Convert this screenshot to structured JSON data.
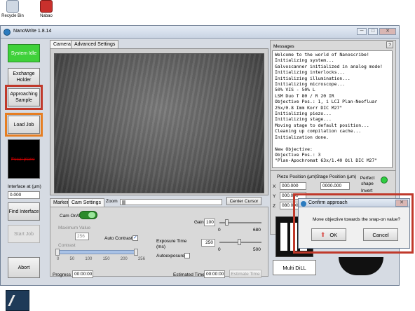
{
  "desktop": {
    "icons": [
      {
        "label": "Recycle Bin"
      },
      {
        "label": "Nabao"
      }
    ]
  },
  "window": {
    "title": "NanoWrite 1.8.14",
    "min": "─",
    "max": "□",
    "close": "✕"
  },
  "left": {
    "status_button": "System Idle",
    "exchange_holder": "Exchange Holder",
    "approaching_sample": "Approaching Sample",
    "load_job": "Load Job",
    "focal_plane": "Focal plane",
    "interface_label": "Interface at (µm)",
    "interface_value": "0.000",
    "find_interface": "Find Interface",
    "start_job": "Start Job",
    "abort": "Abort"
  },
  "tabs": {
    "camera": "Camera",
    "advanced": "Advanced Settings"
  },
  "subtabs": {
    "marker": "Marker",
    "cam_settings": "Cam Settings"
  },
  "zoom": {
    "label": "Zoom"
  },
  "center_cursor": "Center Cursor",
  "cam": {
    "cam_onoff": "Cam On/Off",
    "max_value_label": "Maximum Value",
    "max_value": "256",
    "contrast_label": "Contrast",
    "contrast_ticks": [
      "0",
      "50",
      "100",
      "150",
      "200",
      "256"
    ],
    "auto_contrast": "Auto Contrast",
    "auto_contrast_check": "✓",
    "gain_label": "Gain",
    "gain_value": "100",
    "gain_min": "0",
    "gain_max": "680",
    "exposure_label": "Exposure Time (ms)",
    "exposure_value": "250",
    "exposure_min": "0",
    "exposure_max": "500",
    "autoexposure": "Autoexposure"
  },
  "progress": {
    "label": "Progress",
    "value": "00:00:00"
  },
  "estimated": {
    "label": "Estimated Time",
    "value": "00:00:00",
    "button": "Estimate Time"
  },
  "messages": {
    "title": "Messages",
    "help": "?",
    "text": "Welcome to the world of Nanoscribe!\nInitializing system...\nGalvoscanner initialized in analog mode!\nInitializing interlocks...\nInitializing illumination...\nInitializing microscope...\n50% VIS - 50% L\nLSM Duo T 80 / R 20 IR\nObjective Pos.: 1, i LCI Plan-Neofluar\n25x/0.8 Imm Korr DIC M27\"\nInitializing piezo...\nInitializing stage...\nMoving stage to default position...\nCleaning up compilation cache...\nInitialization done.\n\nNew Objective:\nObjective Pos.: 3\n\"Plan-Apochromat 63x/1.40 Oil DIC M27\""
  },
  "position": {
    "piezo_label": "Piezo Position (µm)",
    "stage_label": "Stage Position (µm)",
    "x_label": "X",
    "y_label": "Y",
    "z_label": "Z",
    "piezo_x": "000.000",
    "piezo_y": "000.000",
    "piezo_z": "080.000",
    "stage_x": "0000.000",
    "perfect_shape": "Perfect shape",
    "invert": "Invert"
  },
  "holder": {
    "label": "Multi DiLL"
  },
  "dialog": {
    "title": "Confirm approach",
    "message": "Move objective towards the snap-on value?",
    "ok": "OK",
    "cancel": "Cancel",
    "close": "✕"
  },
  "colors": {
    "status_green": "#3fd13a",
    "highlight_red": "#c0392b",
    "highlight_orange": "#e67e22",
    "led_green": "#2ecc40"
  }
}
